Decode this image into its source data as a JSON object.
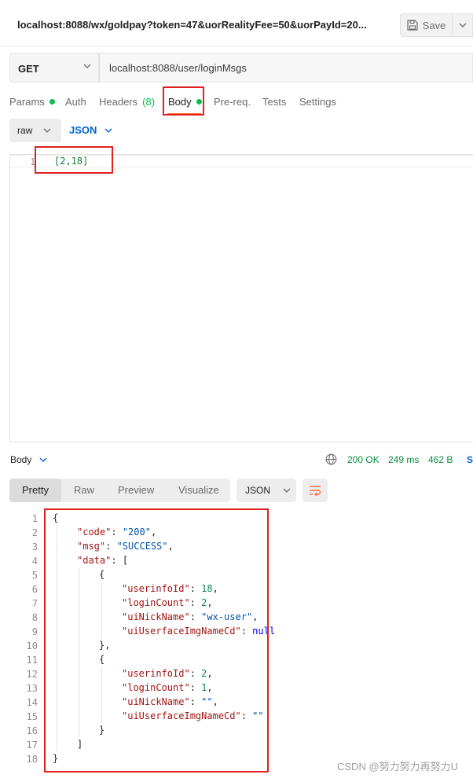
{
  "header": {
    "title": "localhost:8088/wx/goldpay?token=47&uorRealityFee=50&uorPayId=20...",
    "save_label": "Save"
  },
  "request": {
    "method": "GET",
    "url": "localhost:8088/user/loginMsgs",
    "tabs": [
      {
        "label": "Params"
      },
      {
        "label": "Auth"
      },
      {
        "label": "Headers",
        "count": "(8)"
      },
      {
        "label": "Body"
      },
      {
        "label": "Pre-req."
      },
      {
        "label": "Tests"
      },
      {
        "label": "Settings"
      }
    ],
    "body_mode": "raw",
    "body_format": "JSON",
    "body_line_number": "1",
    "body_code": "[2,18]"
  },
  "response": {
    "section_label": "Body",
    "status": "200 OK",
    "time": "249 ms",
    "size": "462 B",
    "save_label": "S",
    "view_tabs": [
      "Pretty",
      "Raw",
      "Preview",
      "Visualize"
    ],
    "format": "JSON",
    "line_numbers": [
      "1",
      "2",
      "3",
      "4",
      "5",
      "6",
      "7",
      "8",
      "9",
      "10",
      "11",
      "12",
      "13",
      "14",
      "15",
      "16",
      "17",
      "18"
    ],
    "tokens": {
      "open_brace": "{",
      "close_brace": "}",
      "open_bracket": "[",
      "close_bracket": "]",
      "item_close_comma": "},",
      "code_key": "\"code\"",
      "code_val": "\"200\"",
      "msg_key": "\"msg\"",
      "msg_val": "\"SUCCESS\"",
      "data_key": "\"data\"",
      "items": [
        {
          "userinfoId_key": "\"userinfoId\"",
          "userinfoId_val": "18",
          "loginCount_key": "\"loginCount\"",
          "loginCount_val": "2",
          "uiNickName_key": "\"uiNickName\"",
          "uiNickName_val": "\"wx-user\"",
          "img_key": "\"uiUserfaceImgNameCd\"",
          "img_val": "null"
        },
        {
          "userinfoId_key": "\"userinfoId\"",
          "userinfoId_val": "2",
          "loginCount_key": "\"loginCount\"",
          "loginCount_val": "1",
          "uiNickName_key": "\"uiNickName\"",
          "uiNickName_val": "\"\"",
          "img_key": "\"uiUserfaceImgNameCd\"",
          "img_val": "\"\""
        }
      ]
    }
  },
  "watermark": "CSDN @努力努力再努力U",
  "colors": {
    "accent_orange": "#ff6c37",
    "status_green": "#0cbb52",
    "annotation_red": "#e0201f",
    "link_blue": "#0265d2"
  }
}
